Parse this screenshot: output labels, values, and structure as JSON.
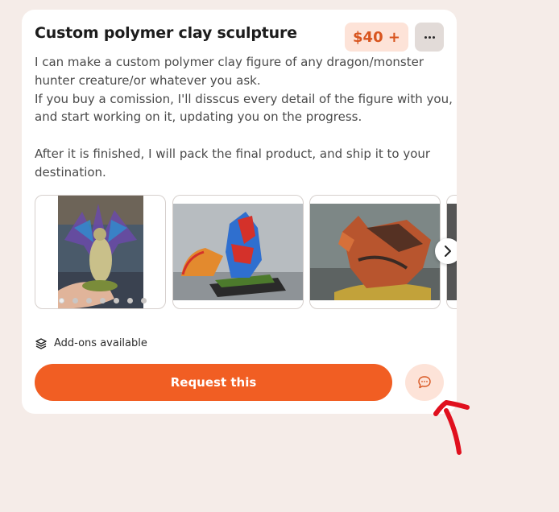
{
  "listing": {
    "title": "Custom polymer clay sculpture",
    "price": "$40 +",
    "description_lines": [
      "I can make a custom polymer clay figure of any dragon/monster",
      "hunter creature/or whatever you ask.",
      "If you buy a comission, I'll disscus every detail of the figure with you,",
      "and start working on it, updating you on the progress.",
      "",
      "After it is finished, I will pack the final product, and ship it to your",
      "destination."
    ]
  },
  "gallery": {
    "image_count": 7,
    "active_index": 0
  },
  "addons": {
    "label": "Add-ons available",
    "icon": "layers-icon"
  },
  "actions": {
    "request_label": "Request this",
    "chat_icon": "chat-bubble-icon"
  },
  "colors": {
    "accent": "#f15e23",
    "accent_soft": "#fde3d8",
    "price_text": "#d8551f",
    "background": "#f5ece8",
    "annotation": "#e0101e"
  }
}
